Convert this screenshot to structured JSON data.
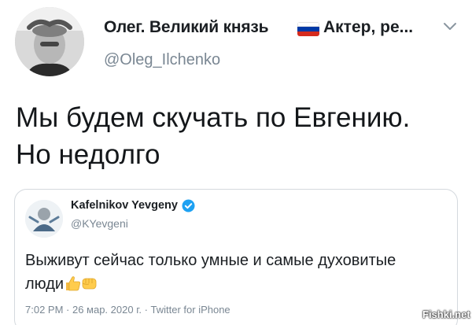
{
  "author": {
    "display_name": "Олег. Великий князь",
    "flag_icon": "russia-flag-icon",
    "display_name_rest": "Актер, ре...",
    "handle": "@Oleg_Ilchenko"
  },
  "tweet": {
    "line_1": "Мы будем скучать по Евгению.",
    "line_2": "Но недолго"
  },
  "quoted_tweet": {
    "display_name": "Kafelnikov Yevgeny",
    "verified_icon": "verified-badge-icon",
    "handle": "@KYevgeni",
    "line_1": "Выживут сейчас только умные и самые духовитые",
    "line_2": "люди",
    "emojis": [
      "thumbs-up-icon",
      "fist-icon"
    ],
    "meta": "7:02 PM · 26 мар. 2020 г. · Twitter for iPhone"
  },
  "watermark": "Fishki.net",
  "colors": {
    "text": "#14171a",
    "secondary_text": "#7a8793",
    "card_border": "#d4d9de",
    "verified_blue": "#1da1f2",
    "flag_white": "#ffffff",
    "flag_blue": "#0039a6",
    "flag_red": "#d52b1e"
  }
}
